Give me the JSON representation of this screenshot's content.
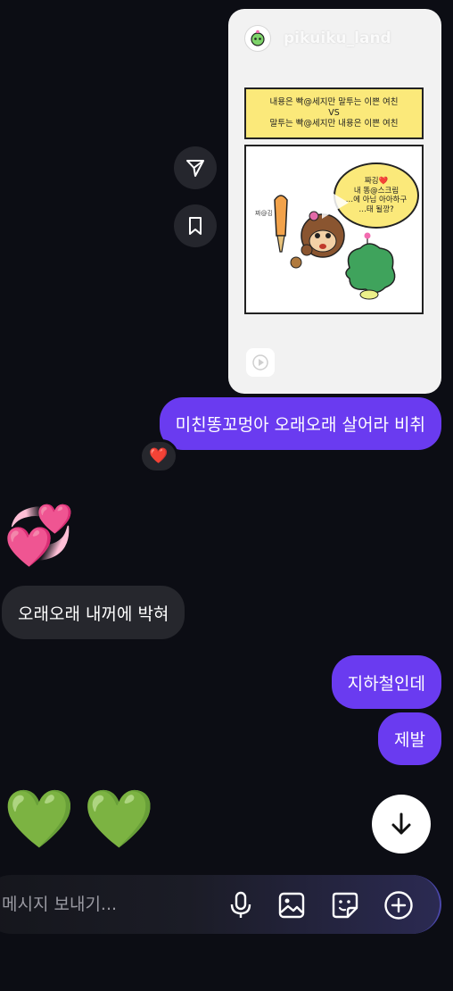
{
  "shared_post": {
    "username": "pikuiku_land",
    "caption_line1": "내용은 빡@세지만 말투는 이쁜 여친",
    "caption_vs": "VS",
    "caption_line2": "말투는 빡@세지만 내용은 이쁜 여친",
    "bubble_line1": "짜깅❤️",
    "bubble_line2": "내 똥@스크림",
    "bubble_line3": "…에 아님 아아하구",
    "bubble_line4": "…태 될깡?",
    "side_label": "짜@깅"
  },
  "messages": [
    {
      "text": "미친똥꼬멍아 오래오래 살어라 비취",
      "sender": "me"
    },
    {
      "text": "오래오래 내꺼에 박혀",
      "sender": "them"
    },
    {
      "text": "지하철인데",
      "sender": "me"
    },
    {
      "text": "제발",
      "sender": "me"
    }
  ],
  "reaction": "❤️",
  "emoji_hearts": "💞",
  "emoji_green_1": "💚",
  "emoji_green_2": "💚",
  "composer": {
    "placeholder": "메시지 보내기..."
  },
  "colors": {
    "background": "#0c0d14",
    "outgoing_bubble": "#6a3bf0",
    "incoming_bubble": "#26272d"
  },
  "icons": {
    "send": "send-icon",
    "save": "bookmark-icon",
    "play": "play-icon",
    "reels": "reels-icon",
    "scroll_down": "arrow-down-icon",
    "mic": "microphone-icon",
    "gallery": "image-icon",
    "sticker": "sticker-icon",
    "more": "plus-circle-icon"
  }
}
